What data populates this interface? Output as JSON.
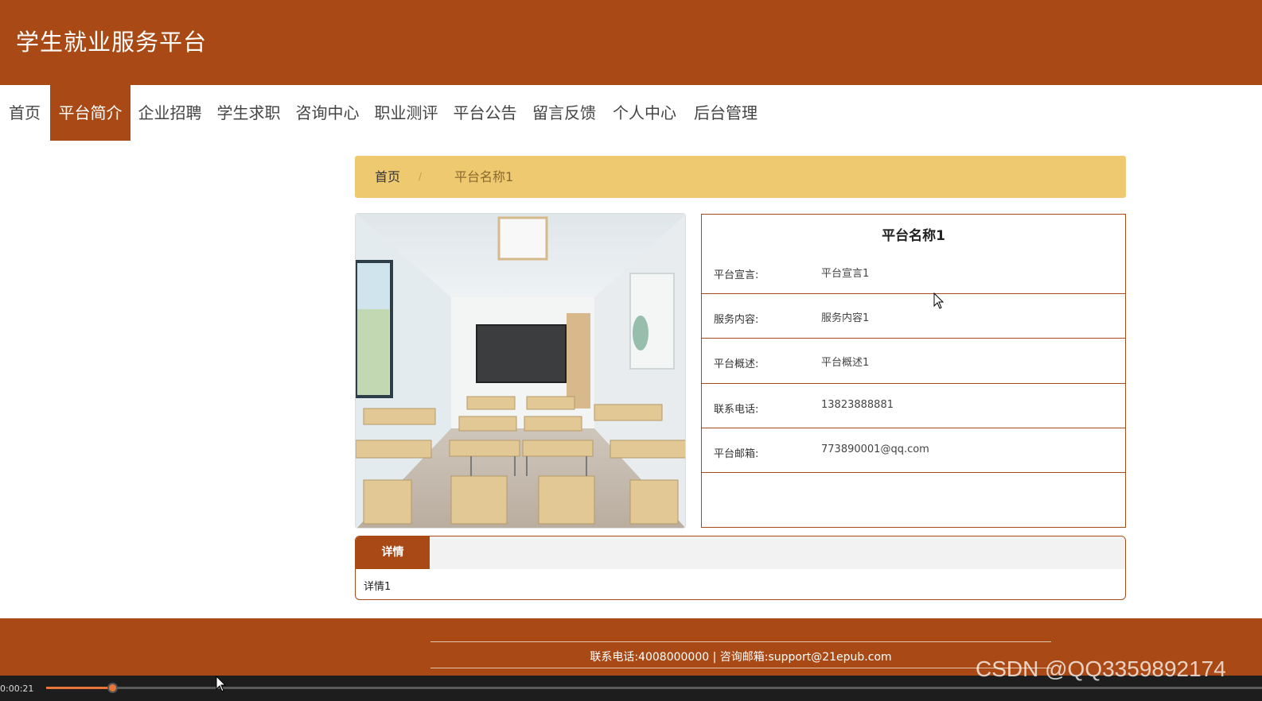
{
  "header": {
    "title": "学生就业服务平台"
  },
  "nav": {
    "items": [
      "首页",
      "平台简介",
      "企业招聘",
      "学生求职",
      "咨询中心",
      "职业测评",
      "平台公告",
      "留言反馈",
      "个人中心",
      "后台管理"
    ],
    "active": "平台简介"
  },
  "breadcrumb": {
    "home": "首页",
    "separator": "/",
    "current": "平台名称1"
  },
  "platform": {
    "name": "平台名称1",
    "fields": [
      {
        "label": "平台宣言:",
        "value": "平台宣言1"
      },
      {
        "label": "服务内容:",
        "value": "服务内容1"
      },
      {
        "label": "平台概述:",
        "value": "平台概述1"
      },
      {
        "label": "联系电话:",
        "value": "13823888881"
      },
      {
        "label": "平台邮箱:",
        "value": "773890001@qq.com"
      }
    ]
  },
  "detail": {
    "tab_label": "详情",
    "content": "详情1"
  },
  "footer": {
    "text": "联系电话:4008000000 | 咨询邮箱:support@21epub.com"
  },
  "player": {
    "time": "0:00:21",
    "progress_fraction": 0.055
  },
  "watermark": "CSDN @QQ3359892174",
  "colors": {
    "brand": "#a94a16",
    "breadcrumb_bg": "#eec970",
    "tab_bg": "#f2f2f2"
  }
}
